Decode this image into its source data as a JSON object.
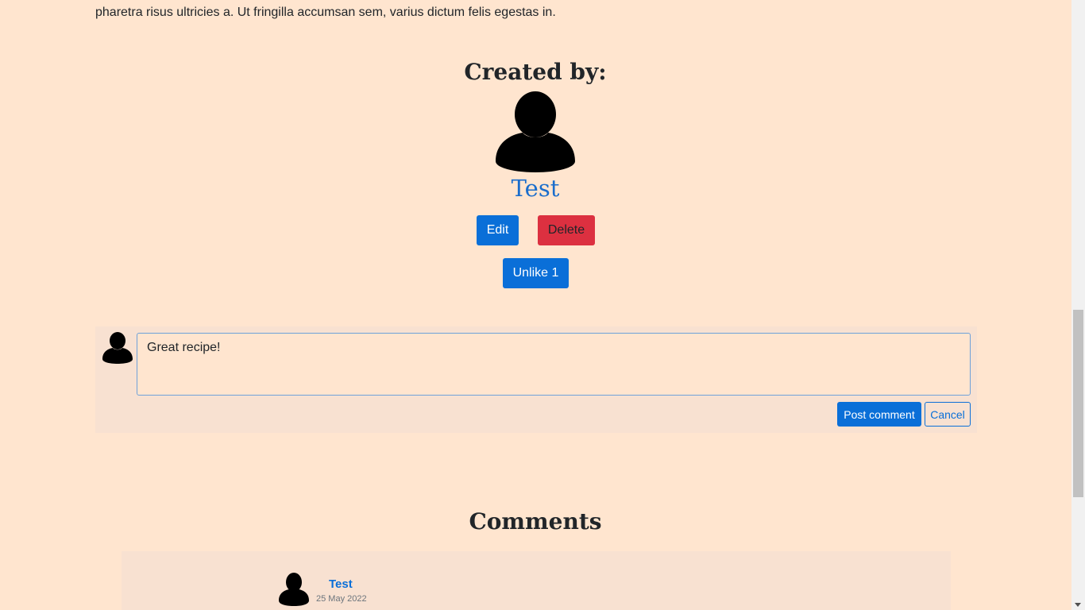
{
  "recipe": {
    "description_tail": "pharetra risus ultricies a. Ut fringilla accumsan sem, varius dictum felis egestas in."
  },
  "author": {
    "heading": "Created by:",
    "avatar_icon": "user-silhouette-icon",
    "name": "Test"
  },
  "actions": {
    "edit_label": "Edit",
    "delete_label": "Delete",
    "unlike_label": "Unlike 1"
  },
  "comment_form": {
    "avatar_icon": "user-silhouette-icon",
    "textarea_value": "Great recipe!",
    "post_label": "Post comment",
    "cancel_label": "Cancel"
  },
  "comments": {
    "heading": "Comments",
    "items": [
      {
        "author": "Test",
        "date": "25 May 2022",
        "avatar_icon": "user-silhouette-icon"
      }
    ]
  },
  "colors": {
    "background": "#ffe5cf",
    "primary": "#0a6fd8",
    "danger": "#dc3040",
    "panel": "#f8e1d1"
  }
}
